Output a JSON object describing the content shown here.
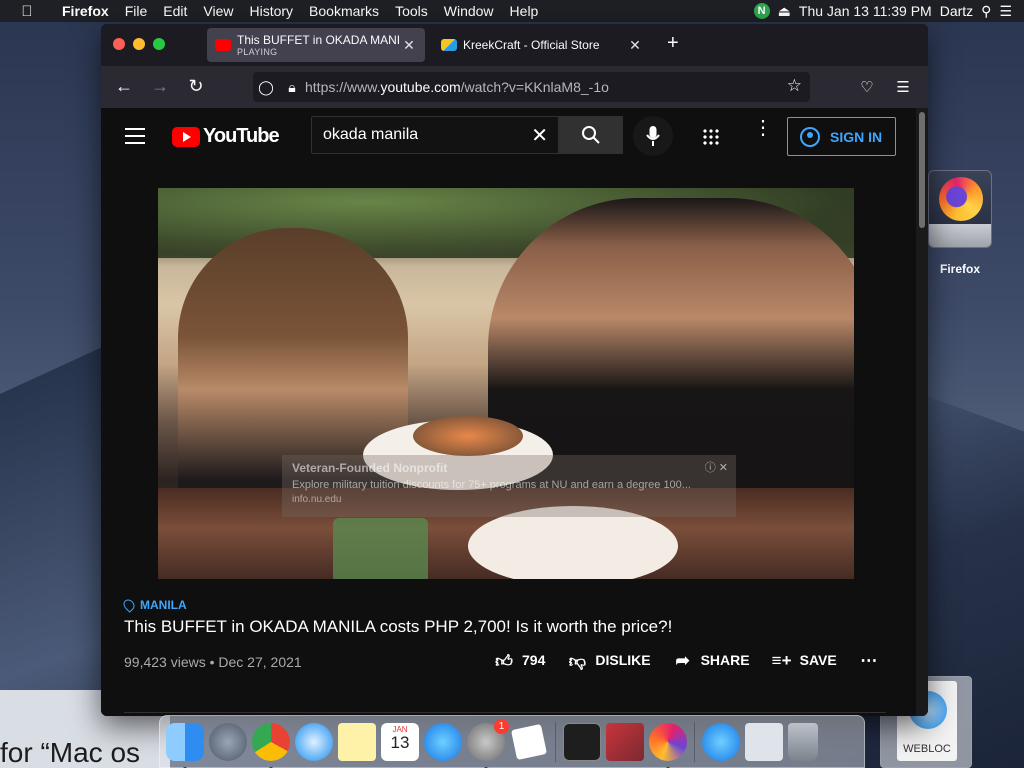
{
  "menubar": {
    "app": "Firefox",
    "items": [
      "File",
      "Edit",
      "View",
      "History",
      "Bookmarks",
      "Tools",
      "Window",
      "Help"
    ],
    "status_badge": "N",
    "datetime": "Thu Jan 13  11:39 PM",
    "user": "Dartz"
  },
  "desktop": {
    "icon_label": "Firefox",
    "webloc_label": "WEBLOC",
    "background_text": "for “Mac os"
  },
  "browser": {
    "tabs": [
      {
        "title": "This BUFFET in OKADA MANILA",
        "subtitle": "PLAYING",
        "active": true
      },
      {
        "title": "KreekCraft - Official Store",
        "active": false
      }
    ],
    "url_prefix": "https://www.",
    "url_host": "youtube.com",
    "url_path": "/watch?v=KKnlaM8_-1o"
  },
  "youtube": {
    "logo_text": "YouTube",
    "search_query": "okada manila",
    "sign_in": "SIGN IN",
    "ad": {
      "title": "Veteran-Founded Nonprofit",
      "description": "Explore military tuition discounts for 75+ programs at NU and earn a degree 100...",
      "url": "info.nu.edu"
    },
    "video": {
      "location_tag": "MANILA",
      "title": "This BUFFET in OKADA MANILA costs PHP 2,700! Is it worth the price?!",
      "stats": "99,423 views • Dec 27, 2021",
      "likes": "794",
      "dislike_label": "DISLIKE",
      "share_label": "SHARE",
      "save_label": "SAVE"
    }
  },
  "dock": {
    "finder_badge": "",
    "prefs_badge": "1",
    "calendar_month": "JAN",
    "calendar_day": "13"
  }
}
